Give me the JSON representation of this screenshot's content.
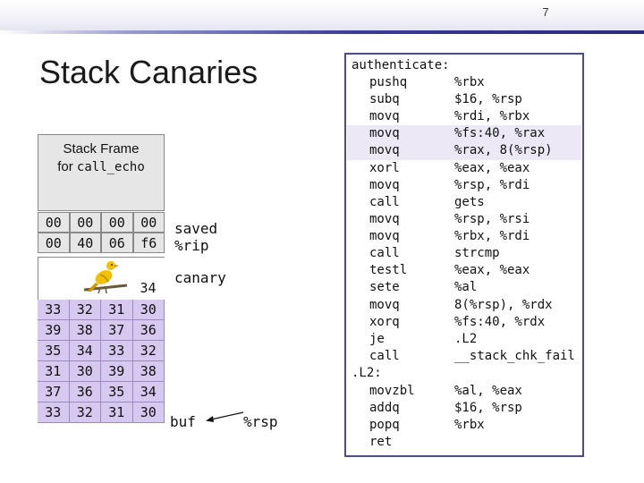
{
  "slide": {
    "number": "7",
    "title": "Stack Canaries"
  },
  "stack_frame": {
    "line1": "Stack Frame",
    "line2_prefix": "for",
    "line2_func": "call_echo"
  },
  "saved_rows": [
    [
      "00",
      "00",
      "00",
      "00"
    ],
    [
      "00",
      "40",
      "06",
      "f6"
    ]
  ],
  "canary_byte": "34",
  "buf_rows": [
    [
      "33",
      "32",
      "31",
      "30"
    ],
    [
      "39",
      "38",
      "37",
      "36"
    ],
    [
      "35",
      "34",
      "33",
      "32"
    ],
    [
      "31",
      "30",
      "39",
      "38"
    ],
    [
      "37",
      "36",
      "35",
      "34"
    ],
    [
      "33",
      "32",
      "31",
      "30"
    ]
  ],
  "labels": {
    "saved": "saved",
    "rip": "%rip",
    "canary": "canary",
    "buf": "buf",
    "rsp": "%rsp"
  },
  "code": [
    {
      "label": "authenticate:"
    },
    {
      "op": "pushq",
      "args": "%rbx"
    },
    {
      "op": "subq",
      "args": "$16, %rsp"
    },
    {
      "op": "movq",
      "args": "%rdi, %rbx"
    },
    {
      "op": "movq",
      "args": "%fs:40, %rax"
    },
    {
      "op": "movq",
      "args": "%rax, 8(%rsp)"
    },
    {
      "op": "xorl",
      "args": "%eax, %eax"
    },
    {
      "op": "movq",
      "args": "%rsp, %rdi"
    },
    {
      "op": "call",
      "args": "gets"
    },
    {
      "op": "movq",
      "args": "%rsp, %rsi"
    },
    {
      "op": "movq",
      "args": "%rbx, %rdi"
    },
    {
      "op": "call",
      "args": "strcmp"
    },
    {
      "op": "testl",
      "args": "%eax, %eax"
    },
    {
      "op": "sete",
      "args": "%al"
    },
    {
      "op": "movq",
      "args": "8(%rsp), %rdx"
    },
    {
      "op": "xorq",
      "args": "%fs:40, %rdx"
    },
    {
      "op": "je",
      "args": ".L2"
    },
    {
      "op": "call",
      "args": "__stack_chk_fail"
    },
    {
      "label": ".L2:"
    },
    {
      "op": "movzbl",
      "args": "%al, %eax"
    },
    {
      "op": "addq",
      "args": "$16, %rsp"
    },
    {
      "op": "popq",
      "args": "%rbx"
    },
    {
      "op": "ret",
      "args": ""
    }
  ],
  "colors": {
    "buffer_fill": "#d6c8ee",
    "frame_fill": "#e6e6e6",
    "code_border": "#4a4aa0",
    "highlight": "#ece8f6",
    "bird": "#f2c100"
  },
  "icons": {
    "canary": "canary-bird-icon"
  }
}
